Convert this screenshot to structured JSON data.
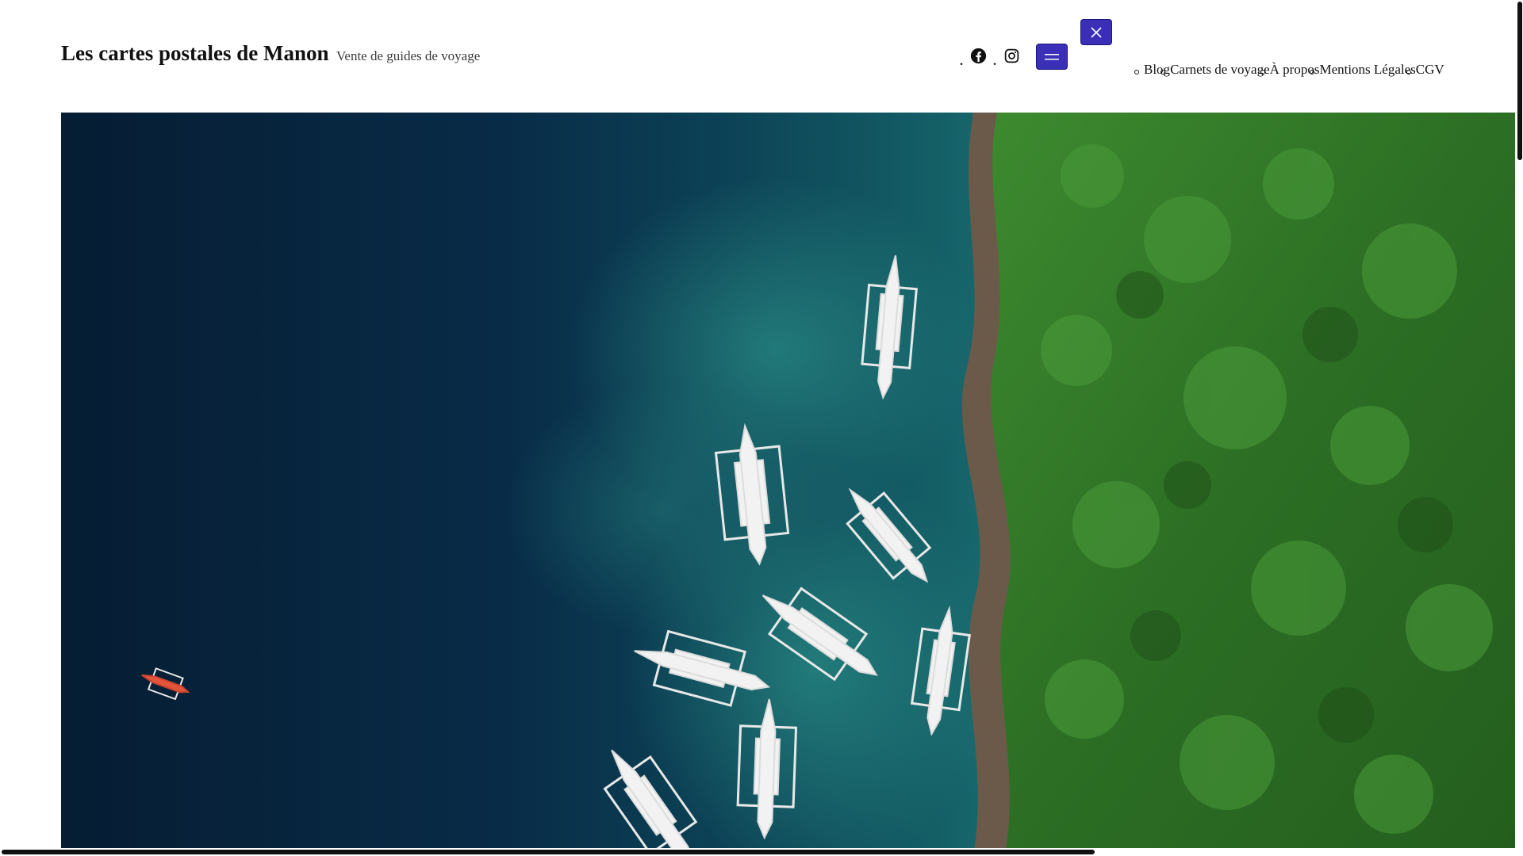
{
  "header": {
    "site_title": "Les cartes postales de Manon",
    "tagline": "Vente de guides de voyage"
  },
  "social": {
    "items": [
      {
        "name": "facebook-icon"
      },
      {
        "name": "instagram-icon"
      }
    ]
  },
  "buttons": {
    "menu_icon": "hamburger-icon",
    "close_icon": "close-icon"
  },
  "nav": {
    "items": [
      {
        "label": "Blog"
      },
      {
        "label": "Carnets de voyage"
      },
      {
        "label": "À propos"
      },
      {
        "label": "Mentions Légales"
      },
      {
        "label": "CGV"
      }
    ]
  },
  "hero": {
    "image_alt": ""
  },
  "colors": {
    "accent": "#3b2fb8",
    "text": "#111111",
    "ocean_deep": "#07263f",
    "ocean_reef": "#1b6f78",
    "forest": "#2f7a2a"
  }
}
